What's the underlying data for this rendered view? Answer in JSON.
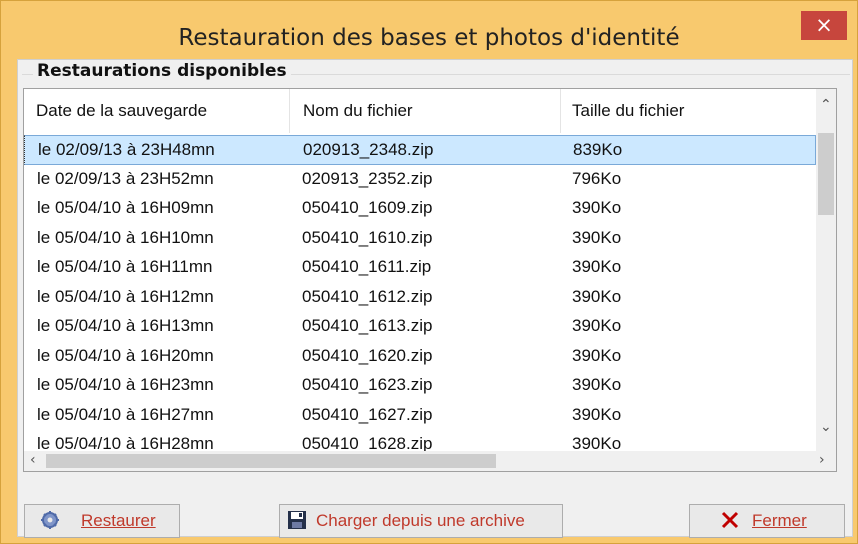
{
  "window": {
    "title": "Restauration des bases et photos d'identité",
    "close": "×"
  },
  "group": {
    "label": "Restaurations disponibles"
  },
  "columns": [
    "Date de la sauvegarde",
    "Nom du fichier",
    "Taille du fichier"
  ],
  "rows": [
    {
      "date": "le 02/09/13 à 23H48mn",
      "file": "020913_2348.zip",
      "size": "839Ko"
    },
    {
      "date": "le 02/09/13 à 23H52mn",
      "file": "020913_2352.zip",
      "size": "796Ko"
    },
    {
      "date": "le 05/04/10 à 16H09mn",
      "file": "050410_1609.zip",
      "size": "390Ko"
    },
    {
      "date": "le 05/04/10 à 16H10mn",
      "file": "050410_1610.zip",
      "size": "390Ko"
    },
    {
      "date": "le 05/04/10 à 16H11mn",
      "file": "050410_1611.zip",
      "size": "390Ko"
    },
    {
      "date": "le 05/04/10 à 16H12mn",
      "file": "050410_1612.zip",
      "size": "390Ko"
    },
    {
      "date": "le 05/04/10 à 16H13mn",
      "file": "050410_1613.zip",
      "size": "390Ko"
    },
    {
      "date": "le 05/04/10 à 16H20mn",
      "file": "050410_1620.zip",
      "size": "390Ko"
    },
    {
      "date": "le 05/04/10 à 16H23mn",
      "file": "050410_1623.zip",
      "size": "390Ko"
    },
    {
      "date": "le 05/04/10 à 16H27mn",
      "file": "050410_1627.zip",
      "size": "390Ko"
    },
    {
      "date": "le 05/04/10 à 16H28mn",
      "file": "050410_1628.zip",
      "size": "390Ko"
    }
  ],
  "selected_row": 0,
  "buttons": {
    "restore": "Restaurer",
    "load_archive": "Charger depuis une archive",
    "close": "Fermer"
  },
  "icons": {
    "restore": "gear-icon",
    "load_archive": "floppy-disk-icon",
    "close": "x-icon",
    "scroll_up": "chevron-up-icon",
    "scroll_down": "chevron-down-icon",
    "scroll_left": "chevron-left-icon",
    "scroll_right": "chevron-right-icon"
  },
  "colors": {
    "titlebar": "#f8c96e",
    "close_button": "#c7463d",
    "selection": "#cce8ff",
    "button_text": "#c0392b"
  }
}
